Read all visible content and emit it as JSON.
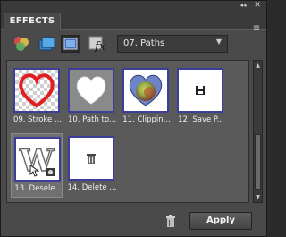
{
  "panel": {
    "tab_label": "EFFECTS",
    "collapse_glyph": "◂◂",
    "close_glyph": "✕",
    "menu_glyph": "≡"
  },
  "toolbar": {
    "tools": [
      {
        "icon": "filters-icon"
      },
      {
        "icon": "layer-styles-icon"
      },
      {
        "icon": "photo-effects-icon"
      },
      {
        "icon": "text-effects-icon"
      }
    ],
    "category_dropdown": {
      "selected": "07. Paths",
      "chevron": "▼"
    }
  },
  "thumbnails": [
    {
      "caption": "09. Stroke ...",
      "kind": "heart-outline"
    },
    {
      "caption": "10. Path to...",
      "kind": "heart-white"
    },
    {
      "caption": "11. Clippin...",
      "kind": "heart-fill"
    },
    {
      "caption": "12. Save P...",
      "kind": "save"
    },
    {
      "caption": "13. Desele...",
      "kind": "w-deselect"
    },
    {
      "caption": "14. Delete ...",
      "kind": "delete"
    }
  ],
  "footer": {
    "apply_label": "Apply"
  },
  "colors": {
    "thumb_border": "#3c3f9a",
    "panel_bg": "#4a4a4a"
  }
}
